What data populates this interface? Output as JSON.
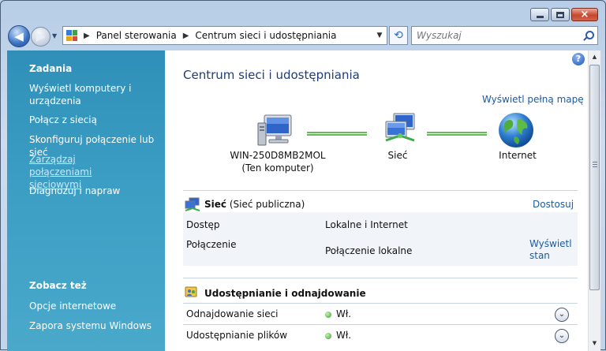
{
  "window": {
    "caption_buttons": {
      "minimize": "minimize-icon",
      "maximize": "maximize-icon",
      "close": "close-icon"
    }
  },
  "nav": {
    "address": {
      "crumbs": [
        "Panel sterowania",
        "Centrum sieci i udostępniania"
      ]
    },
    "search": {
      "placeholder": "Wyszukaj"
    }
  },
  "sidebar": {
    "tasks_heading": "Zadania",
    "tasks": [
      {
        "label": "Wyświetl komputery i urządzenia"
      },
      {
        "label": "Połącz z siecią"
      },
      {
        "label": "Skonfiguruj połączenie lub sieć"
      },
      {
        "label": "Zarządzaj połączeniami sieciowymi",
        "active": true
      },
      {
        "label": "Diagnozuj i napraw"
      }
    ],
    "see_also_heading": "Zobacz też",
    "see_also": [
      {
        "label": "Opcje internetowe"
      },
      {
        "label": "Zapora systemu Windows"
      }
    ]
  },
  "main": {
    "title": "Centrum sieci i udostępniania",
    "full_map_link": "Wyświetl pełną mapę",
    "map": {
      "computer": {
        "name": "WIN-250D8MB2MOL",
        "sub": "(Ten komputer)"
      },
      "network": {
        "name": "Sieć"
      },
      "internet": {
        "name": "Internet"
      }
    },
    "network_section": {
      "title": "Sieć",
      "type": "(Sieć publiczna)",
      "customize_link": "Dostosuj",
      "rows": [
        {
          "label": "Dostęp",
          "value": "Lokalne i Internet"
        },
        {
          "label": "Połączenie",
          "value": "Połączenie lokalne",
          "link": "Wyświetl stan"
        }
      ]
    },
    "sharing_section": {
      "title": "Udostępnianie i odnajdowanie",
      "rows": [
        {
          "label": "Odnajdowanie sieci",
          "value": "Wł."
        },
        {
          "label": "Udostępnianie plików",
          "value": "Wł."
        }
      ]
    }
  },
  "colors": {
    "sidebar": "#3c9ec4",
    "link": "#1b5aa6",
    "title": "#1e3d78",
    "status_on": "#38a12c"
  }
}
